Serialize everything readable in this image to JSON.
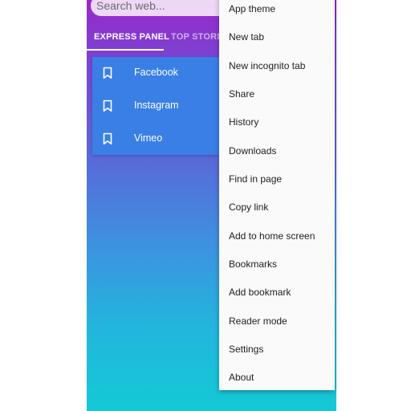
{
  "search": {
    "placeholder": "Search web..."
  },
  "tabs": [
    {
      "label": "EXPRESS PANEL"
    },
    {
      "label": "TOP STORIES"
    }
  ],
  "bookmarks": [
    {
      "label": "Facebook",
      "icon": "bookmark-icon"
    },
    {
      "label": "Instagram",
      "icon": "bookmark-icon"
    },
    {
      "label": "Vimeo",
      "icon": "bookmark-icon"
    }
  ],
  "menu": {
    "items": [
      {
        "label": "App theme"
      },
      {
        "label": "New tab"
      },
      {
        "label": "New incognito tab"
      },
      {
        "label": "Share"
      },
      {
        "label": "History"
      },
      {
        "label": "Downloads"
      },
      {
        "label": "Find in page"
      },
      {
        "label": "Copy link"
      },
      {
        "label": "Add to home screen"
      },
      {
        "label": "Bookmarks"
      },
      {
        "label": "Add bookmark"
      },
      {
        "label": "Reader mode"
      },
      {
        "label": "Settings"
      },
      {
        "label": "About"
      }
    ]
  },
  "colors": {
    "gradient_top": "#9a27c9",
    "gradient_bottom": "#14c9d6",
    "bookmark_panel": "#3a7fe6",
    "menu_bg": "#fafafa"
  }
}
